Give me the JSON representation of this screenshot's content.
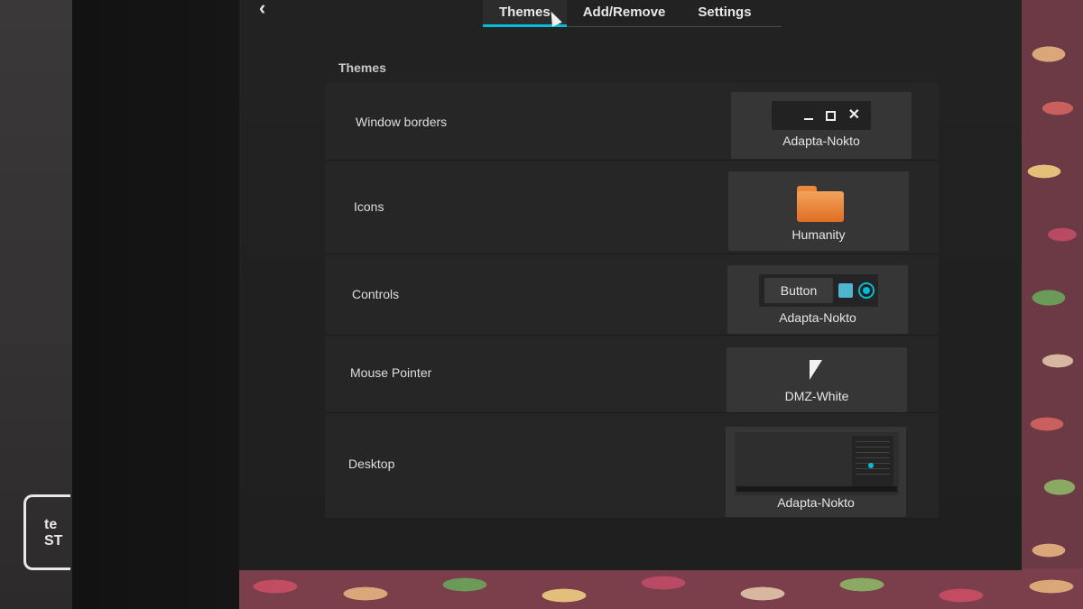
{
  "header": {
    "back_icon": "chevron-left-icon",
    "tabs": [
      {
        "label": "Themes",
        "active": true
      },
      {
        "label": "Add/Remove",
        "active": false
      },
      {
        "label": "Settings",
        "active": false
      }
    ]
  },
  "section": {
    "title": "Themes",
    "rows": [
      {
        "label": "Window borders",
        "value": "Adapta-Nokto"
      },
      {
        "label": "Icons",
        "value": "Humanity"
      },
      {
        "label": "Controls",
        "value": "Adapta-Nokto",
        "button_label": "Button"
      },
      {
        "label": "Mouse Pointer",
        "value": "DMZ-White"
      },
      {
        "label": "Desktop",
        "value": "Adapta-Nokto"
      }
    ]
  },
  "dock": {
    "badge_text": "te\nST"
  },
  "colors": {
    "accent": "#00bcd4",
    "folder": "#e06d24",
    "window_bg": "#222222",
    "row_bg": "#262626",
    "preview_bg": "#363636"
  }
}
